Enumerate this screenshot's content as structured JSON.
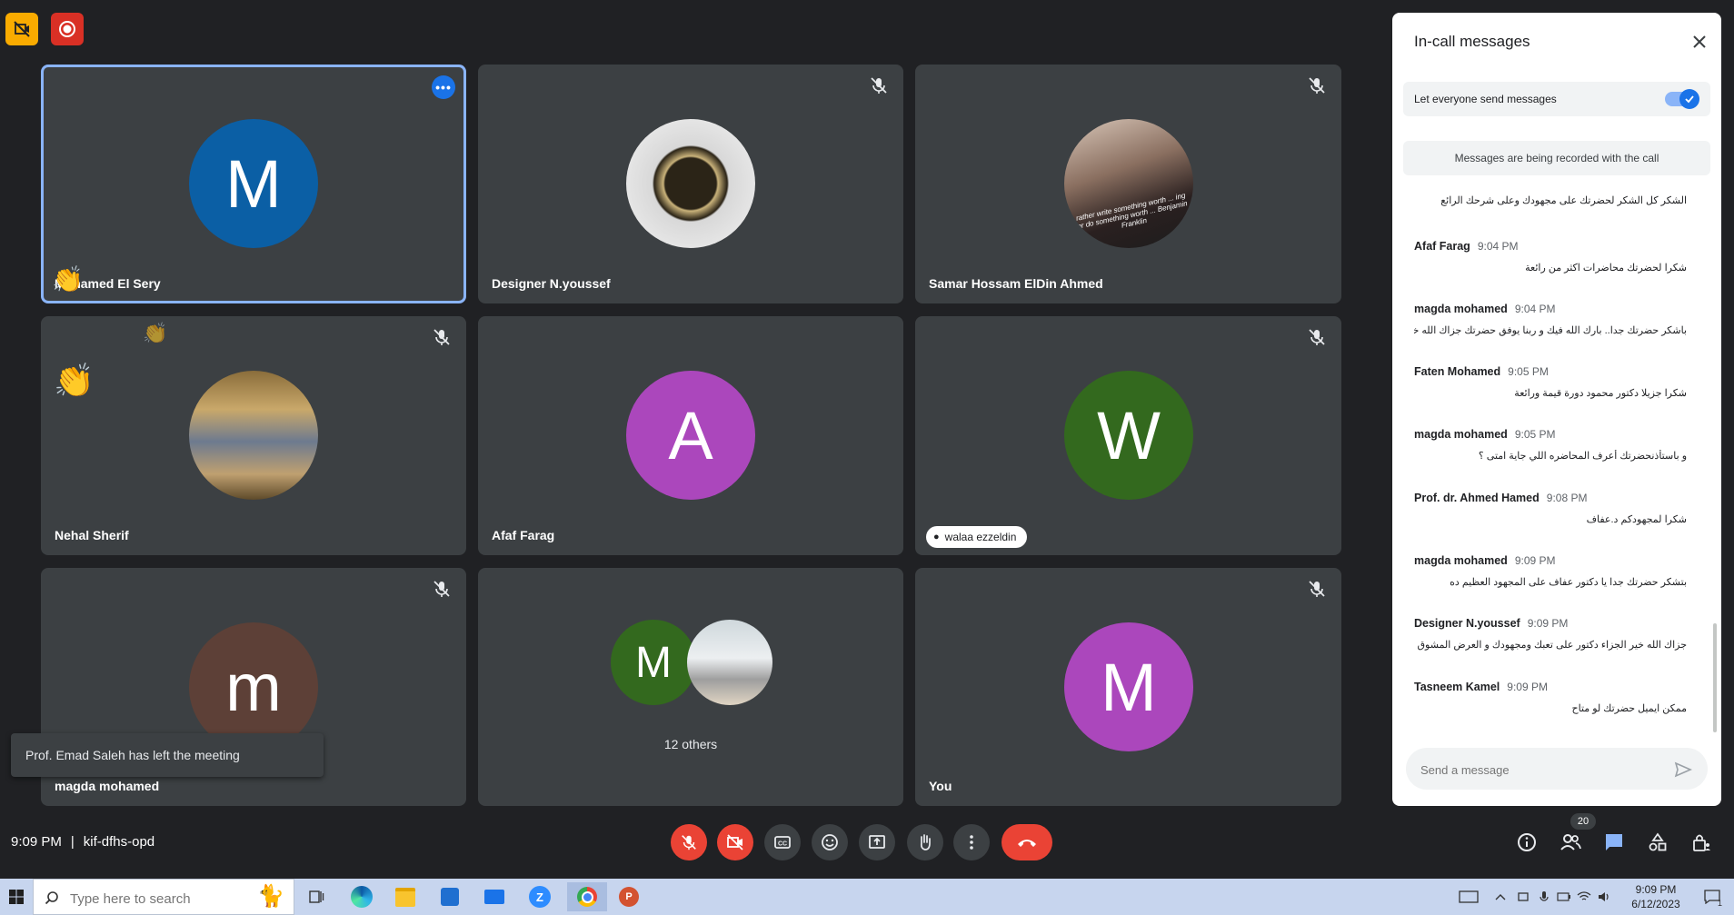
{
  "toast": "Prof. Emad Saleh has left the meeting",
  "meeting": {
    "time": "9:09 PM",
    "separator": "|",
    "code": "kif-dfhs-opd"
  },
  "tiles": [
    {
      "name": "Mohamed El Sery",
      "initial": "M"
    },
    {
      "name": "Designer N.youssef"
    },
    {
      "name": "Samar Hossam ElDin Ahmed",
      "photo_caption": "rather write something worth ... ing or do something worth ... Benjamin Franklin"
    },
    {
      "name": "Nehal Sherif"
    },
    {
      "name": "Afaf Farag",
      "initial": "A"
    },
    {
      "name": "walaa ezzeldin",
      "initial": "W"
    },
    {
      "name": "magda mohamed",
      "initial": "m"
    },
    {
      "name": "12 others",
      "initial": "M"
    },
    {
      "name": "You",
      "initial": "M"
    }
  ],
  "panel": {
    "title": "In-call messages",
    "toggle_label": "Let everyone send messages",
    "recording_notice": "Messages are being recorded with the call",
    "first_fragment": "الشكر كل الشكر لحضرتك على مجهودك وعلى شرحك الرائع",
    "messages": [
      {
        "sender": "Afaf Farag",
        "time": "9:04 PM",
        "text": "شكرا لحضرتك محاضرات اكثر من رائعة"
      },
      {
        "sender": "magda mohamed",
        "time": "9:04 PM",
        "text": "باشكر حضرتك جدا.. بارك الله فيك و ربنا يوفق حضرتك جزاك الله خيرا"
      },
      {
        "sender": "Faten Mohamed",
        "time": "9:05 PM",
        "text": "شكرا جزيلا دكتور محمود دورة قيمة ورائعة"
      },
      {
        "sender": "magda mohamed",
        "time": "9:05 PM",
        "text": "و باستأذنحضرتك أعرف المحاضره اللي جاية امتى ؟"
      },
      {
        "sender": "Prof. dr. Ahmed Hamed",
        "time": "9:08 PM",
        "text": "شكرا لمجهودكم د.عفاف"
      },
      {
        "sender": "magda mohamed",
        "time": "9:09 PM",
        "text": "بتشكر حضرتك جدا يا دكتور عفاف على المجهود العظيم ده"
      },
      {
        "sender": "Designer N.youssef",
        "time": "9:09 PM",
        "text": "جزاك الله خير الجزاء دكتور على تعبك ومجهودك و العرض المشوق"
      },
      {
        "sender": "Tasneem Kamel",
        "time": "9:09 PM",
        "text": "ممكن ايميل حضرتك لو متاح"
      }
    ],
    "input_placeholder": "Send a message"
  },
  "people_count": "20",
  "taskbar": {
    "search_placeholder": "Type here to search",
    "clock_time": "9:09 PM",
    "clock_date": "6/12/2023",
    "notif_count": "1"
  },
  "colors": {
    "avatar_blue": "#0b5fa5",
    "avatar_purple": "#ab47bc",
    "avatar_green": "#33691e",
    "avatar_brown": "#5d4037",
    "end_call": "#ea4335",
    "accent": "#1a73e8"
  }
}
